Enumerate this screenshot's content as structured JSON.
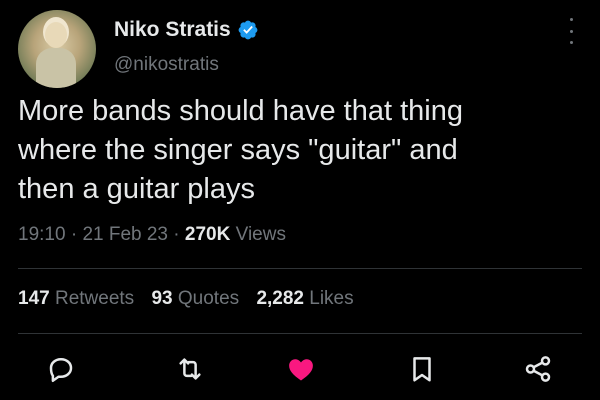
{
  "tweet": {
    "author_name": "Niko Stratis",
    "handle": "@nikostratis",
    "text_lines": [
      "More bands should have that thing",
      "where the singer says \"guitar\" and",
      "then a guitar plays"
    ],
    "time": "19:10",
    "date": "21 Feb 23",
    "sep": "·",
    "views_count": "270K",
    "views_label": "Views"
  },
  "stats": {
    "retweets_count": "147",
    "retweets_label": "Retweets",
    "quotes_count": "93",
    "quotes_label": "Quotes",
    "likes_count": "2,282",
    "likes_label": "Likes"
  },
  "actions": {
    "reply_icon": "reply-icon",
    "retweet_icon": "retweet-icon",
    "like_icon": "heart-icon",
    "like_active": true,
    "bookmark_icon": "bookmark-icon",
    "share_icon": "share-icon"
  },
  "colors": {
    "background": "#000000",
    "text_primary": "#e7e9ea",
    "text_secondary": "#71767b",
    "verified_blue": "#1d9bf0",
    "like_pink": "#f91880",
    "divider": "#2f3336"
  }
}
